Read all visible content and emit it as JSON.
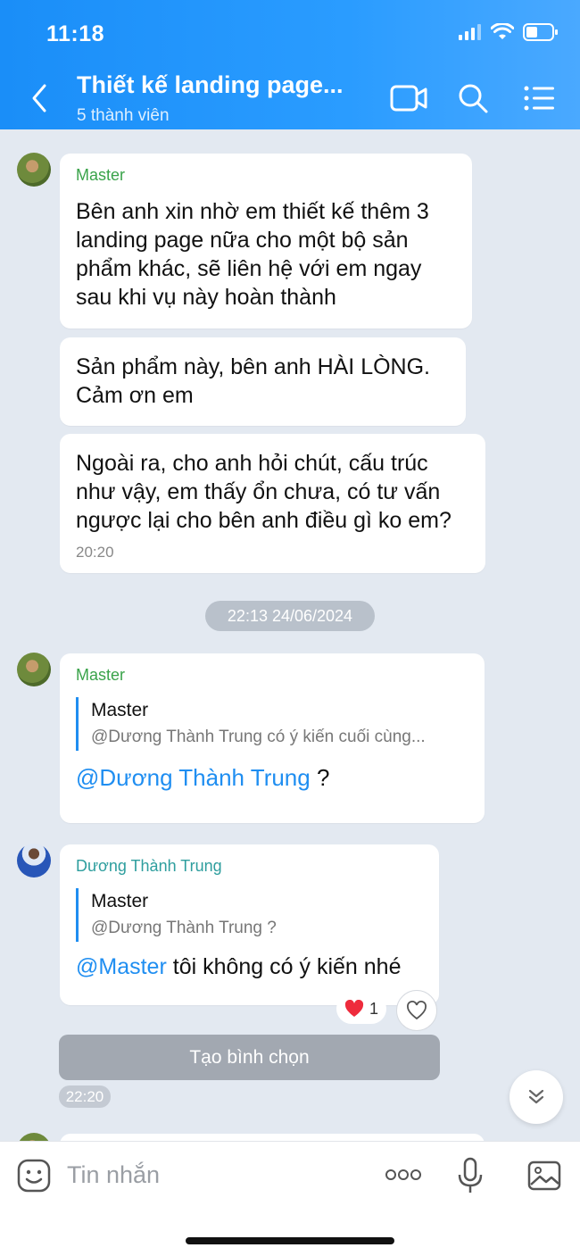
{
  "status": {
    "time": "11:18"
  },
  "header": {
    "title": "Thiết kế landing page...",
    "subtitle": "5 thành viên"
  },
  "messages": {
    "m1": {
      "sender": "Master",
      "text": "Bên anh xin nhờ em thiết kế thêm 3 landing page nữa cho một bộ sản phẩm khác, sẽ liên hệ với em ngay sau khi vụ này hoàn thành"
    },
    "m2": {
      "text": "Sản phẩm này, bên anh HÀI LÒNG. Cảm ơn em"
    },
    "m3": {
      "text": "Ngoài ra, cho anh hỏi chút, cấu trúc như vậy, em thấy ổn chưa, có tư vấn ngược lại cho bên anh điều gì ko em?",
      "time": "20:20"
    },
    "date_separator": "22:13 24/06/2024",
    "m4": {
      "sender": "Master",
      "quote_name": "Master",
      "quote_text": "@Dương Thành Trung có ý kiến cuối cùng...",
      "mention": "@Dương Thành Trung",
      "text_after": " ?"
    },
    "m5": {
      "sender": "Dương Thành Trung",
      "quote_name": "Master",
      "quote_text": "@Dương Thành Trung ?",
      "mention": "@Master",
      "text_after": " tôi không có ý kiến nhé",
      "reaction_count": "1"
    },
    "poll_button": "Tạo bình chọn",
    "last_time": "22:20"
  },
  "input": {
    "placeholder": "Tin nhắn"
  },
  "colors": {
    "header_blue": "#1a8ef8",
    "mention_blue": "#1f8ef1",
    "sender_green": "#3aa34a",
    "sender_teal": "#2e9e9e"
  },
  "icons": [
    "back-icon",
    "video-call-icon",
    "search-icon",
    "menu-list-icon",
    "heart-icon",
    "chevron-down-icon",
    "emoji-icon",
    "more-icon",
    "mic-icon",
    "image-icon"
  ]
}
